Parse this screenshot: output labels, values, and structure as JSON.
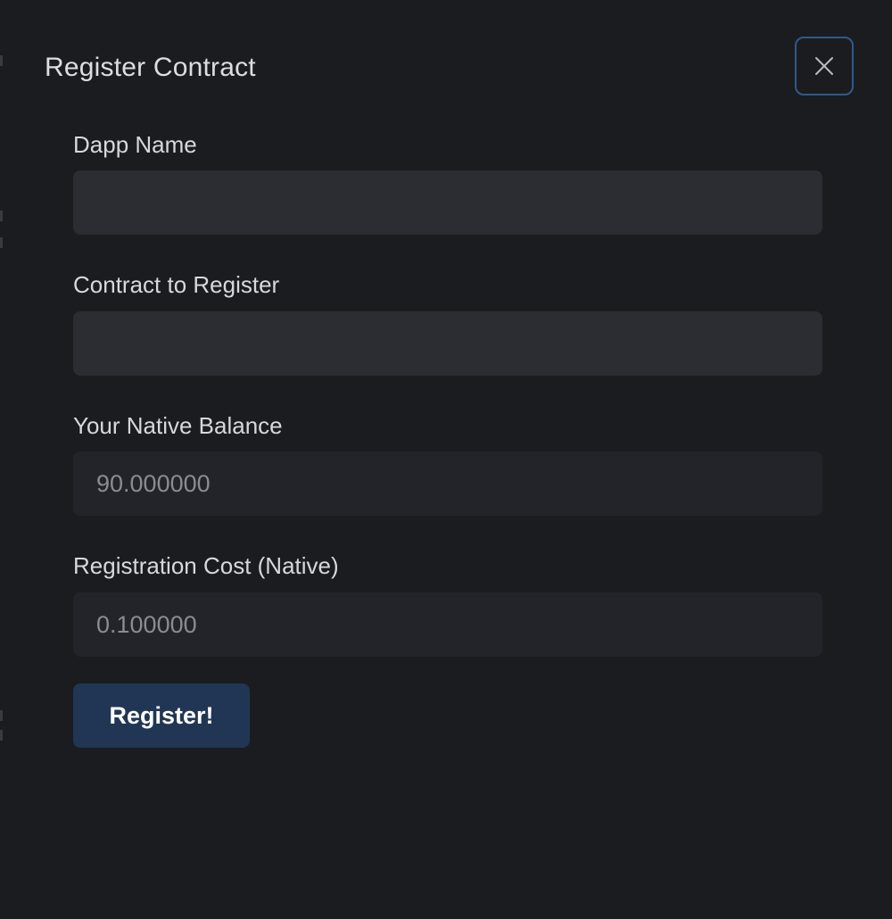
{
  "modal": {
    "title": "Register Contract",
    "close_icon": "close-icon"
  },
  "form": {
    "dapp_name": {
      "label": "Dapp Name",
      "value": ""
    },
    "contract": {
      "label": "Contract to Register",
      "value": ""
    },
    "native_balance": {
      "label": "Your Native Balance",
      "value": "90.000000"
    },
    "registration_cost": {
      "label": "Registration Cost (Native)",
      "value": "0.100000"
    },
    "submit_label": "Register!"
  },
  "colors": {
    "background": "#1b1c20",
    "input_background": "#2c2d33",
    "readonly_background": "#232429",
    "button_background": "#213654",
    "close_border": "#2e5a8c"
  }
}
